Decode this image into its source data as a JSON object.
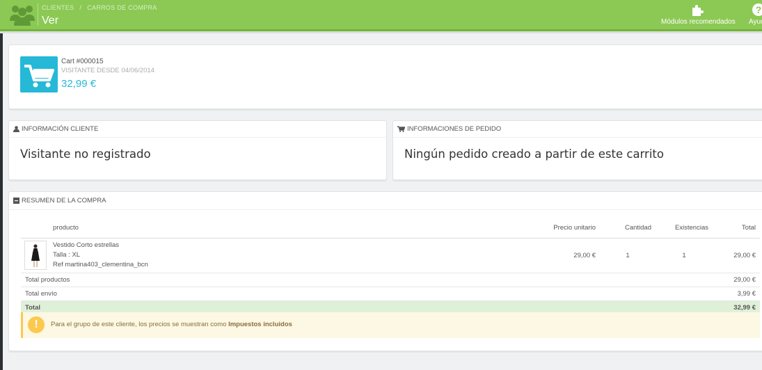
{
  "header": {
    "breadcrumb": [
      "CLIENTES",
      "CARROS DE COMPRA"
    ],
    "breadcrumb_sep": "/",
    "title": "Ver",
    "modules_label": "Módulos recomendados",
    "help_label": "Ayuda"
  },
  "cart": {
    "id": "Cart #000015",
    "visitor_since": "VISITANTE DESDE 04/06/2014",
    "total": "32,99 €"
  },
  "customer_panel": {
    "heading": "INFORMACIÓN CLIENTE",
    "body": "Visitante no registrado"
  },
  "order_panel": {
    "heading": "INFORMACIONES DE PEDIDO",
    "body": "Ningún pedido creado a partir de este carrito"
  },
  "summary": {
    "heading": "RESUMEN DE LA COMPRA",
    "columns": {
      "product": "producto",
      "unit_price": "Precio unitario",
      "quantity": "Cantidad",
      "stock": "Existencias",
      "total": "Total"
    },
    "product": {
      "name": "Vestido Corto estrellas",
      "variant": "Talla : XL",
      "ref": "Ref martina403_clementina_bcn",
      "unit_price": "29,00 €",
      "quantity": "1",
      "stock": "1",
      "total": "29,00 €"
    },
    "totals": {
      "products_label": "Total productos",
      "products_value": "29,00 €",
      "shipping_label": "Total envío",
      "shipping_value": "3,99 €",
      "grand_label": "Total",
      "grand_value": "32,99 €"
    },
    "alert_text": "Para el grupo de este cliente, los precios se muestran como ",
    "alert_bold": "Impuestos incluidos"
  },
  "colors": {
    "header_green": "#8bc954",
    "accent_blue": "#25b9d7",
    "success_bg": "#dff0d8",
    "warning_bg": "#fcf8e3"
  },
  "icons": {
    "header": "users-icon",
    "modules": "puzzle-icon",
    "help": "help-icon",
    "cart": "shopping-cart-icon",
    "customer": "user-icon",
    "order": "cart-icon",
    "summary": "minus-square-icon",
    "alert": "exclamation-icon"
  }
}
